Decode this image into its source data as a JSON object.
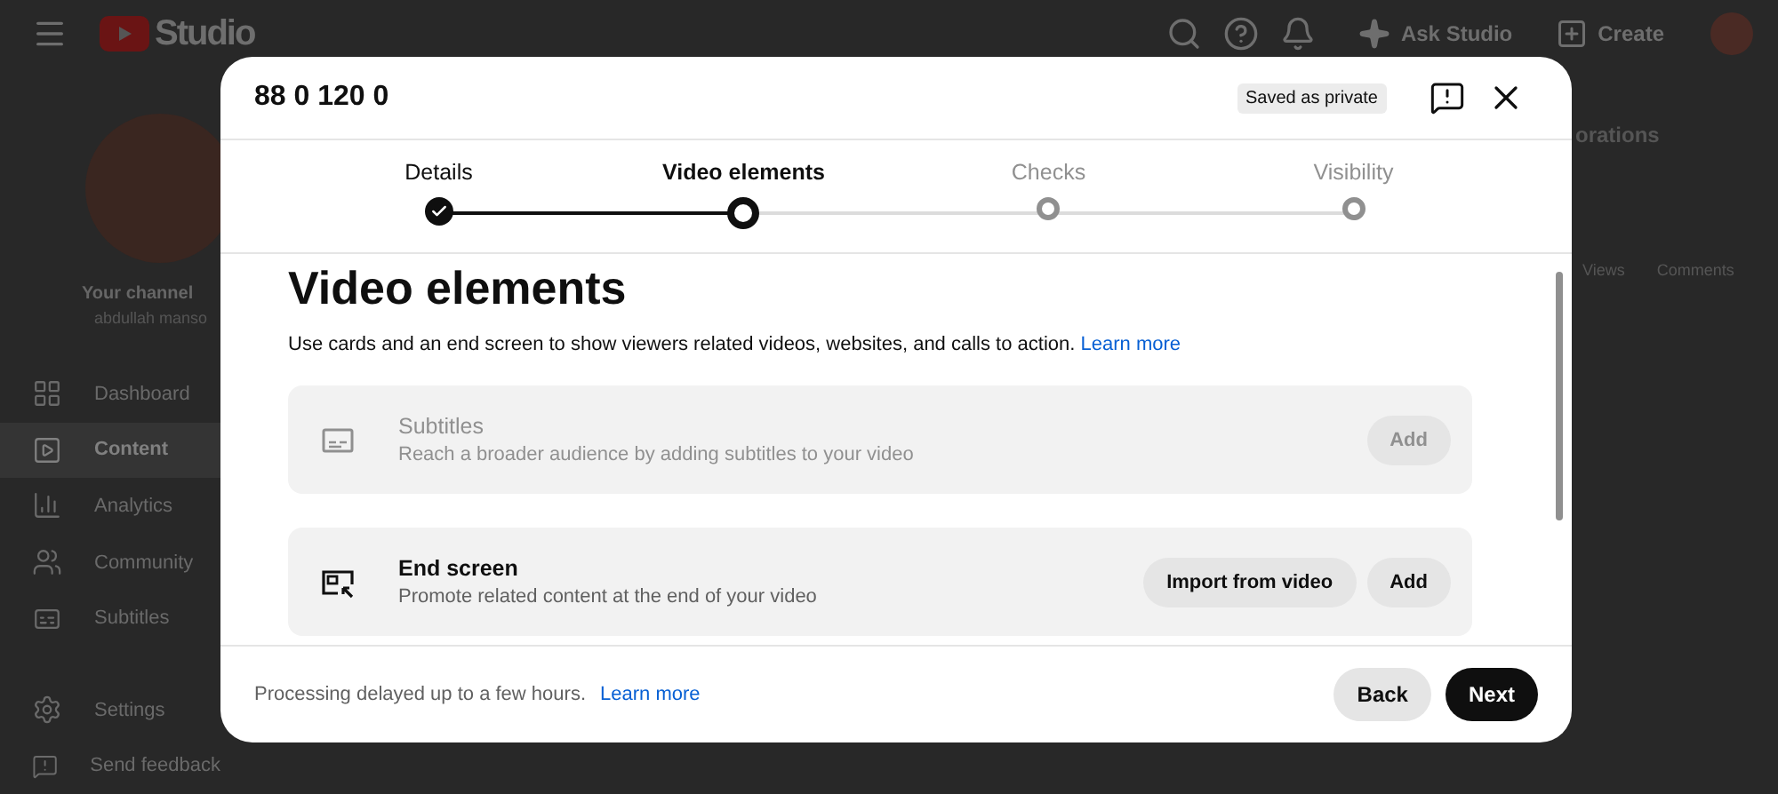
{
  "app_bar": {
    "logo_text": "Studio",
    "ask_label": "Ask Studio",
    "create_label": "Create"
  },
  "sidebar": {
    "channel_label": "Your channel",
    "channel_name": "abdullah manso",
    "items": [
      {
        "label": "Dashboard",
        "kind": "dashboard",
        "selected": false
      },
      {
        "label": "Content",
        "kind": "content",
        "selected": true
      },
      {
        "label": "Analytics",
        "kind": "analytics",
        "selected": false
      },
      {
        "label": "Community",
        "kind": "community",
        "selected": false
      },
      {
        "label": "Subtitles",
        "kind": "subtitles",
        "selected": false
      }
    ],
    "bottom_items": [
      {
        "label": "Settings",
        "kind": "settings"
      },
      {
        "label": "Send feedback",
        "kind": "feedback"
      }
    ]
  },
  "background_page": {
    "tab": "orations",
    "columns": [
      "Views",
      "Comments"
    ]
  },
  "dialog": {
    "title": "88 0 120 0",
    "save_status": "Saved as private",
    "steps": [
      {
        "label": "Details",
        "selected": false
      },
      {
        "label": "Video elements",
        "selected": true
      },
      {
        "label": "Checks",
        "selected": false
      },
      {
        "label": "Visibility",
        "selected": false
      }
    ],
    "heading": "Video elements",
    "intro": "Use cards and an end screen to show viewers related videos, websites, and calls to action.",
    "intro_link": "Learn more",
    "cards": [
      {
        "kind": "subtitles",
        "title": "Subtitles",
        "description": "Reach a broader audience by adding subtitles to your video",
        "disabled": true,
        "buttons": [
          "Add"
        ]
      },
      {
        "kind": "end_screen",
        "title": "End screen",
        "description": "Promote related content at the end of your video",
        "disabled": false,
        "buttons": [
          "Import from video",
          "Add"
        ]
      }
    ],
    "footer_note": "Processing delayed up to a few hours.",
    "footer_link": "Learn more",
    "back_label": "Back",
    "next_label": "Next"
  }
}
